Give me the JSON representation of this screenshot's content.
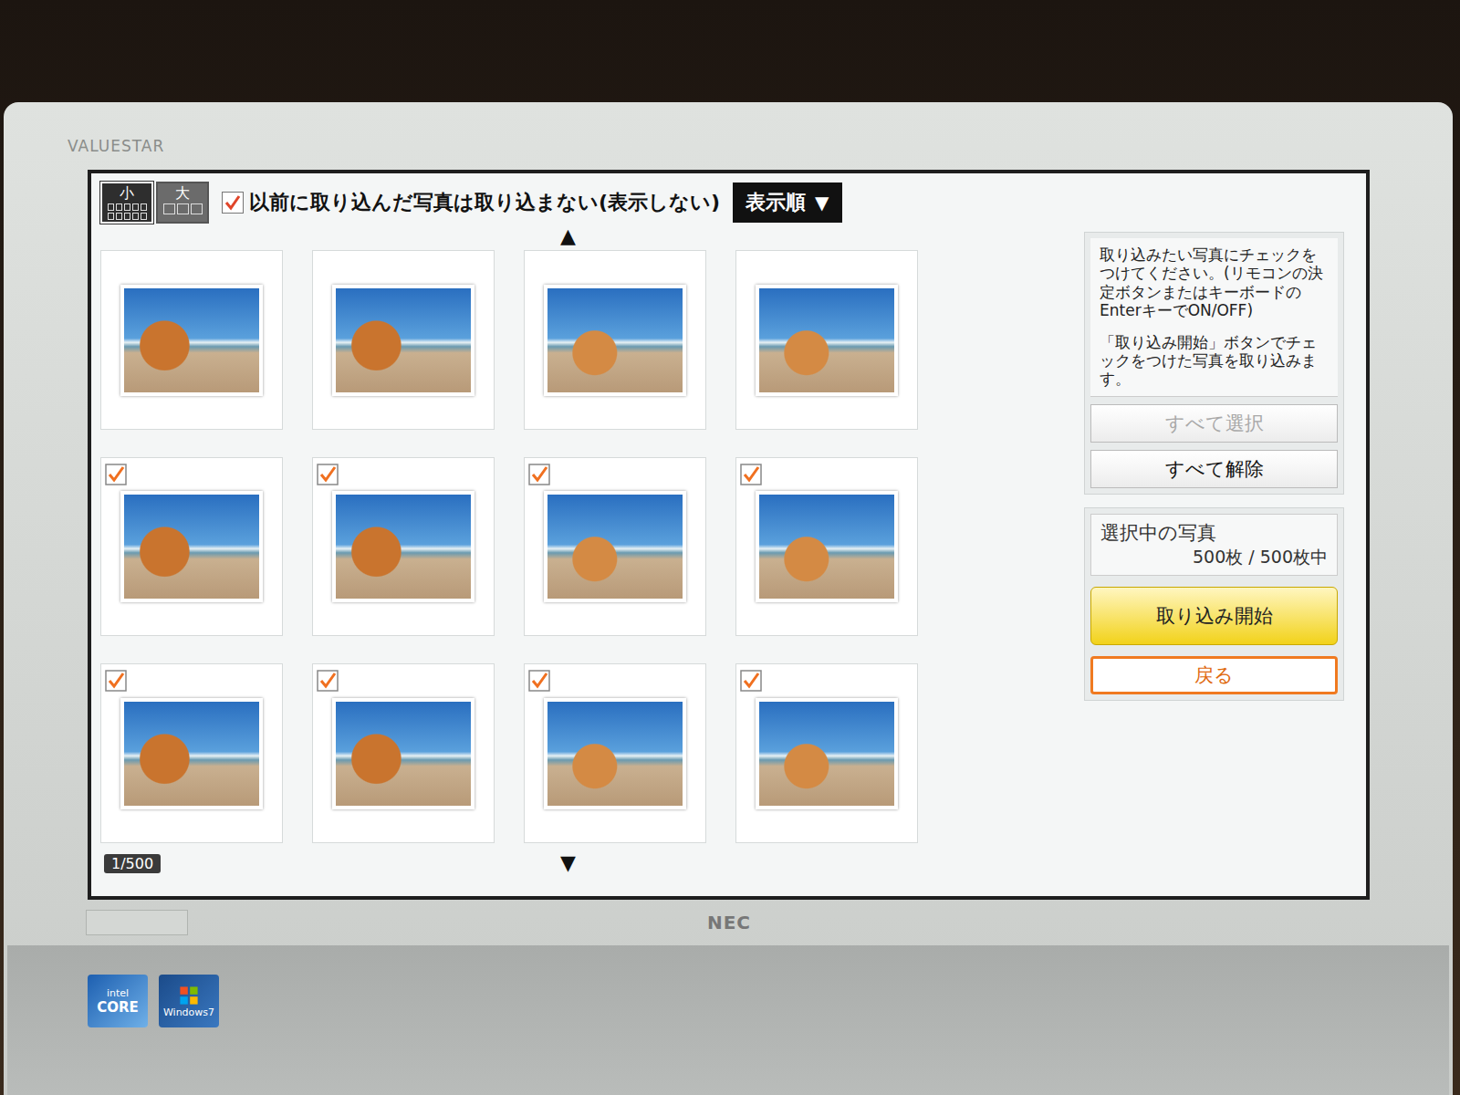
{
  "monitor": {
    "brand": "VALUESTAR",
    "maker": "NEC",
    "stickers": [
      "intel",
      "CORE",
      "Windows7"
    ]
  },
  "toolbar": {
    "size_buttons": [
      {
        "label": "小",
        "cells": 10,
        "selected": true
      },
      {
        "label": "大",
        "cells": 3,
        "selected": false
      }
    ],
    "skip_imported": {
      "label": "以前に取り込んだ写真は取り込まない(表示しない)",
      "checked": true
    },
    "sort": {
      "label": "表示順",
      "icon": "▼"
    }
  },
  "scroll": {
    "up": "▲",
    "down": "▼"
  },
  "photos": [
    {
      "checked": false
    },
    {
      "checked": false
    },
    {
      "checked": false
    },
    {
      "checked": false
    },
    {
      "checked": true
    },
    {
      "checked": true
    },
    {
      "checked": true
    },
    {
      "checked": true
    },
    {
      "checked": true
    },
    {
      "checked": true
    },
    {
      "checked": true
    },
    {
      "checked": true
    }
  ],
  "page_counter": "1/500",
  "side": {
    "instructions": [
      "取り込みたい写真にチェックをつけてください。(リモコンの決定ボタンまたはキーボードのEnterキーでON/OFF)",
      "「取り込み開始」ボタンでチェックをつけた写真を取り込みます。"
    ],
    "select_all": {
      "label": "すべて選択",
      "disabled": true
    },
    "clear_all": {
      "label": "すべて解除",
      "disabled": false
    },
    "selection": {
      "title": "選択中の写真",
      "count": "500枚 / 500枚中"
    },
    "start": "取り込み開始",
    "back": {
      "label": "戻る",
      "focused": true
    }
  }
}
